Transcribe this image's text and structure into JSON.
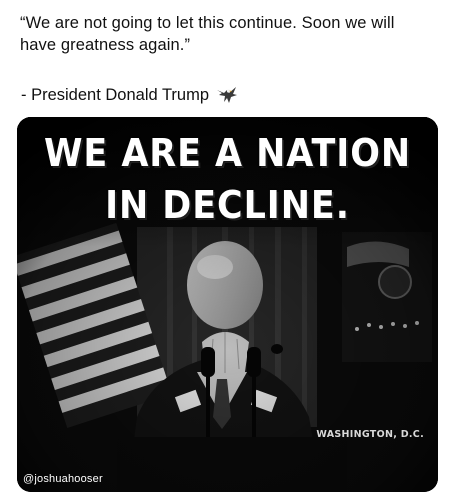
{
  "post": {
    "quote_line1": "“We are not going to let this continue. Soon we will",
    "quote_line2": "have greatness again.”",
    "attribution": "- President Donald Trump",
    "attribution_icon": "eagle-icon"
  },
  "media": {
    "headline_line1": "WE ARE A NATION",
    "headline_line2": "IN DECLINE.",
    "location_caption": "WASHINGTON, D.C.",
    "watermark_handle": "@joshuahooser"
  },
  "colors": {
    "page_background": "#ffffff",
    "text": "#111111",
    "media_background": "#070707",
    "headline_text": "#ffffff"
  }
}
